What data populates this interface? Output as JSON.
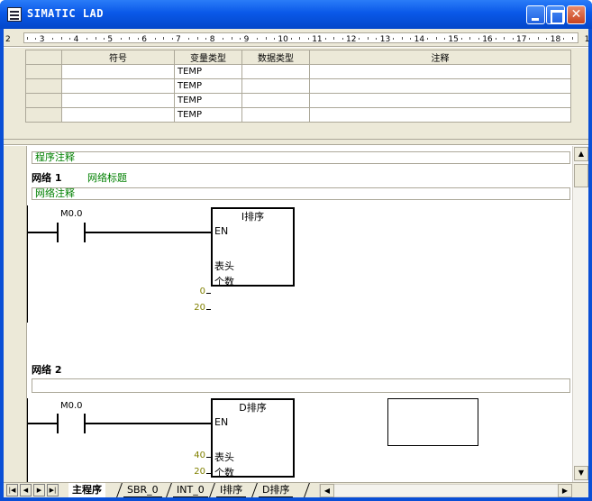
{
  "window": {
    "title": "SIMATIC LAD"
  },
  "ruler": {
    "labels": [
      "2",
      "3",
      "4",
      "5",
      "6",
      "7",
      "8",
      "9",
      "10",
      "11",
      "12",
      "13",
      "14",
      "15",
      "16",
      "17",
      "18",
      "1"
    ]
  },
  "var_table": {
    "headers": [
      "符号",
      "变量类型",
      "数据类型",
      "注释"
    ],
    "rows": [
      {
        "symbol": "",
        "var_type": "TEMP",
        "data_type": "",
        "comment": ""
      },
      {
        "symbol": "",
        "var_type": "TEMP",
        "data_type": "",
        "comment": ""
      },
      {
        "symbol": "",
        "var_type": "TEMP",
        "data_type": "",
        "comment": ""
      },
      {
        "symbol": "",
        "var_type": "TEMP",
        "data_type": "",
        "comment": ""
      }
    ]
  },
  "editor": {
    "program_comment": "程序注释",
    "networks": [
      {
        "label": "网络 1",
        "title": "网络标题",
        "comment": "网络注释",
        "contact": "M0.0",
        "box": {
          "title": "I排序",
          "en": "EN",
          "inputs": [
            {
              "name": "表头",
              "value": "0"
            },
            {
              "name": "个数",
              "value": "20"
            }
          ]
        }
      },
      {
        "label": "网络 2",
        "title": "",
        "comment": "",
        "contact": "M0.0",
        "box": {
          "title": "D排序",
          "en": "EN",
          "inputs": [
            {
              "name": "表头",
              "value": "40"
            },
            {
              "name": "个数",
              "value": "20"
            }
          ]
        }
      }
    ]
  },
  "tabs": [
    "主程序",
    "SBR_0",
    "INT_0",
    "I排序",
    "D排序"
  ],
  "colors": {
    "titlebar": "#0a58e8",
    "comment_text": "#008000",
    "pin_value": "#808000"
  }
}
